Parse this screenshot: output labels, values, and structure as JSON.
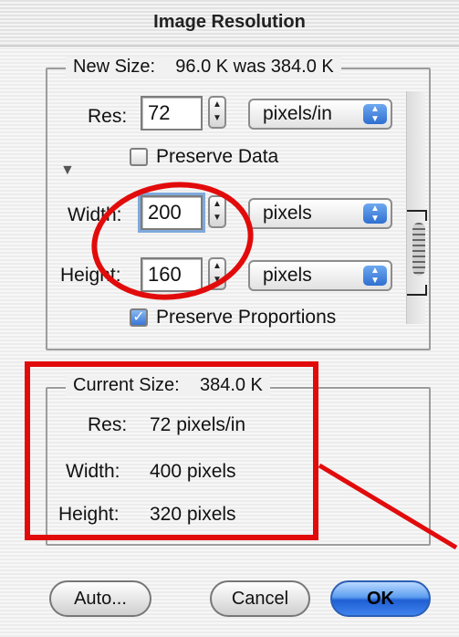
{
  "window": {
    "title": "Image Resolution"
  },
  "new_size": {
    "legend_label": "New Size:",
    "legend_value": "96.0 K was 384.0 K",
    "res_label": "Res:",
    "res_value": "72",
    "res_unit": "pixels/in",
    "preserve_data_label": "Preserve Data",
    "preserve_data_checked": false,
    "width_label": "Width:",
    "width_value": "200",
    "width_unit": "pixels",
    "height_label": "Height:",
    "height_value": "160",
    "height_unit": "pixels",
    "preserve_proportions_label": "Preserve Proportions",
    "preserve_proportions_checked": true
  },
  "current_size": {
    "legend_label": "Current Size:",
    "legend_value": "384.0 K",
    "res_label": "Res:",
    "res_value": "72 pixels/in",
    "width_label": "Width:",
    "width_value": "400 pixels",
    "height_label": "Height:",
    "height_value": "320 pixels"
  },
  "buttons": {
    "auto": "Auto...",
    "cancel": "Cancel",
    "ok": "OK"
  },
  "icons": {
    "disclosure": "disclosure-triangle-icon",
    "stepper": "stepper-icon",
    "select_arrow": "select-arrow-icon",
    "chain": "chain-link-icon",
    "checkmark": "checkmark-icon"
  },
  "colors": {
    "annotation_red": "#e20b0b",
    "ok_blue": "#3e83ee"
  }
}
